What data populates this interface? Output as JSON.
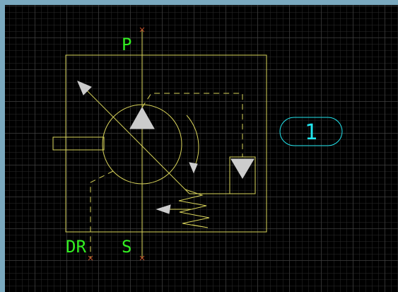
{
  "drawing": {
    "ports": {
      "pressure": "P",
      "suction": "S",
      "drain": "DR"
    },
    "balloon": {
      "number": "1"
    }
  },
  "colors": {
    "background": "#000000",
    "frame": "#7aa9bf",
    "symbol_lines": "#d8d35a",
    "port_labels": "#33ee22",
    "balloon": "#22e6ee",
    "port_marker": "#c0502a",
    "arrowheads": "#cccccc"
  }
}
